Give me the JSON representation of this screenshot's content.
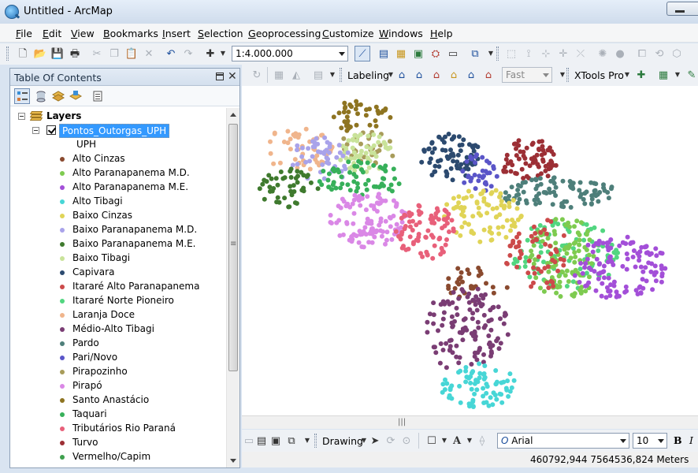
{
  "window": {
    "title": "Untitled - ArcMap"
  },
  "menu": [
    "File",
    "Edit",
    "View",
    "Bookmarks",
    "Insert",
    "Selection",
    "Geoprocessing",
    "Customize",
    "Windows",
    "Help"
  ],
  "standard_toolbar": {
    "scale": "1:4.000.000"
  },
  "labeling_toolbar": {
    "labeling_label": "Labeling",
    "speed": "Fast",
    "xtools_label": "XTools Pro"
  },
  "toc": {
    "title": "Table Of Contents",
    "root": "Layers",
    "layer": "Pontos_Outorgas_UPH",
    "field": "UPH",
    "legend": [
      {
        "label": "Alto Cinzas",
        "color": "#8a4a2f"
      },
      {
        "label": "Alto Paranapanema M.D.",
        "color": "#7ecb50"
      },
      {
        "label": "Alto Paranapanema M.E.",
        "color": "#a34fd8"
      },
      {
        "label": "Alto Tibagi",
        "color": "#47d6d6"
      },
      {
        "label": "Baixo Cinzas",
        "color": "#e0d457"
      },
      {
        "label": "Baixo Paranapanema M.D.",
        "color": "#a9a3ea"
      },
      {
        "label": "Baixo Paranapanema M.E.",
        "color": "#3f7a2e"
      },
      {
        "label": "Baixo Tibagi",
        "color": "#c9e39a"
      },
      {
        "label": "Capivara",
        "color": "#2c4a6f"
      },
      {
        "label": "Itararé Alto Paranapanema",
        "color": "#cc4a4a"
      },
      {
        "label": "Itararé Norte Pioneiro",
        "color": "#52d680"
      },
      {
        "label": "Laranja Doce",
        "color": "#f0b58c"
      },
      {
        "label": "Médio-Alto Tibagi",
        "color": "#7a3d74"
      },
      {
        "label": "Pardo",
        "color": "#4e7f7a"
      },
      {
        "label": "Pari/Novo",
        "color": "#5a55c8"
      },
      {
        "label": "Pirapozinho",
        "color": "#a89c5a"
      },
      {
        "label": "Pirapó",
        "color": "#da88e6"
      },
      {
        "label": "Santo Anastácio",
        "color": "#8e7421"
      },
      {
        "label": "Taquari",
        "color": "#37b05a"
      },
      {
        "label": "Tributários Rio Paraná",
        "color": "#e8607a"
      },
      {
        "label": "Turvo",
        "color": "#9c2f35"
      },
      {
        "label": "Vermelho/Capim",
        "color": "#3ea04e"
      }
    ]
  },
  "drawing_toolbar": {
    "drawing_label": "Drawing",
    "font": "Arial",
    "font_size": "10",
    "bold": "B",
    "italic": "I"
  },
  "status": {
    "coordinates": "460792,944  7564536,824 Meters"
  }
}
